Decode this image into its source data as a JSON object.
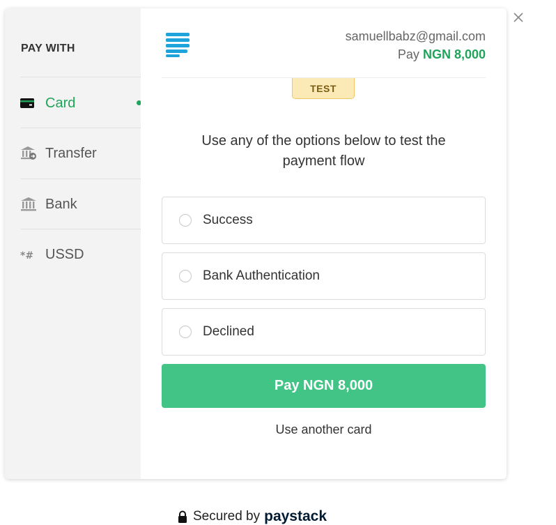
{
  "sidebar": {
    "heading": "PAY WITH",
    "items": [
      {
        "label": "Card",
        "icon": "card-icon",
        "active": true
      },
      {
        "label": "Transfer",
        "icon": "bank-transfer-icon",
        "active": false
      },
      {
        "label": "Bank",
        "icon": "bank-icon",
        "active": false
      },
      {
        "label": "USSD",
        "icon": "ussd-icon",
        "active": false
      }
    ]
  },
  "header": {
    "email": "samuellbabz@gmail.com",
    "pay_prefix": "Pay",
    "amount": "NGN 8,000"
  },
  "badge": "TEST",
  "intro": "Use any of the options below to test the payment flow",
  "options": [
    {
      "label": "Success"
    },
    {
      "label": "Bank Authentication"
    },
    {
      "label": "Declined"
    }
  ],
  "pay_button": "Pay NGN 8,000",
  "another_card": "Use another card",
  "footer": {
    "secured_text": "Secured by",
    "brand": "paystack"
  },
  "colors": {
    "accent": "#20a35a",
    "button": "#41c486",
    "logo": "#1fa3db",
    "badge_bg": "#fbeab5"
  }
}
